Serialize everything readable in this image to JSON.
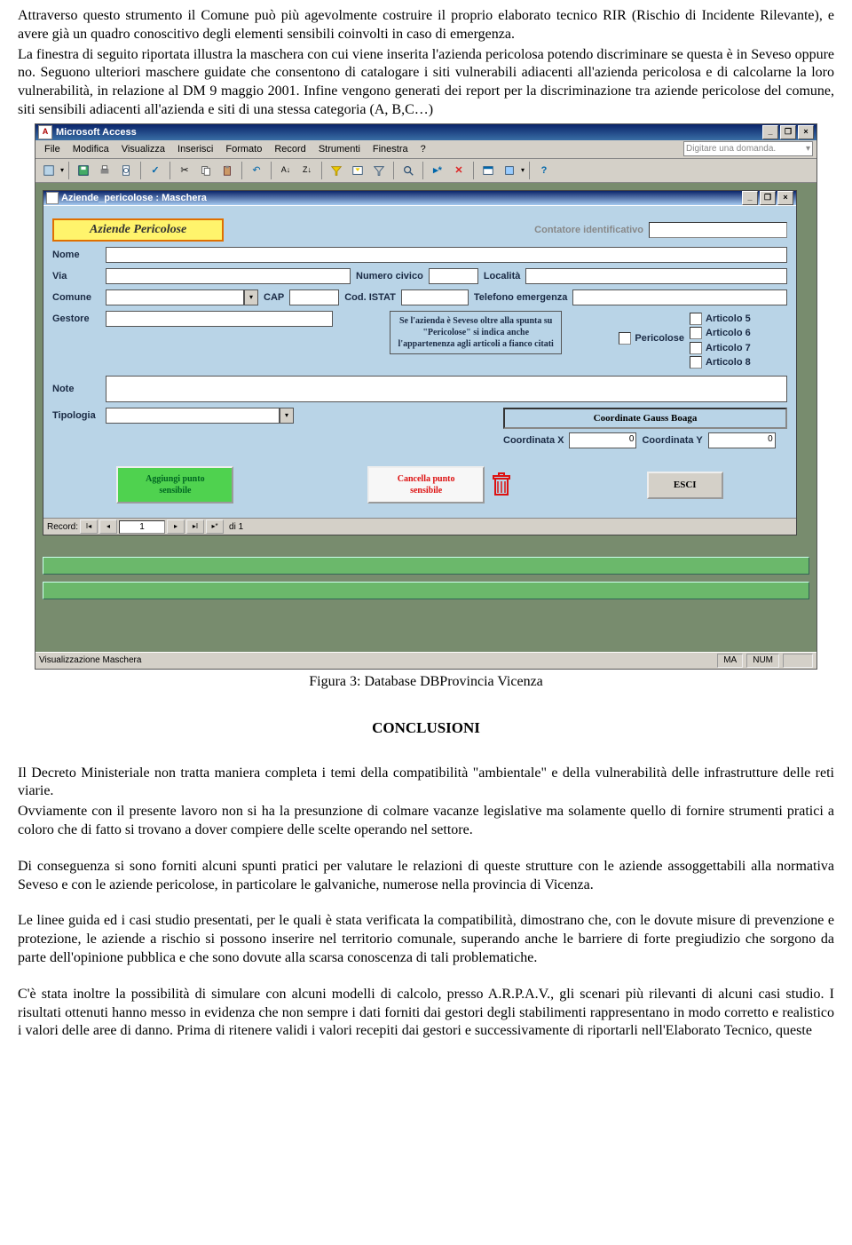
{
  "para1": "Attraverso questo strumento il Comune può più agevolmente costruire il proprio elaborato tecnico RIR (Rischio di Incidente Rilevante), e avere già un quadro conoscitivo degli elementi sensibili coinvolti in caso di emergenza.",
  "para2": "La finestra di seguito riportata illustra la maschera con cui viene inserita l'azienda pericolosa potendo discriminare se questa è in Seveso oppure no. Seguono ulteriori maschere guidate che consentono di catalogare i siti vulnerabili adiacenti all'azienda pericolosa e di calcolarne la loro vulnerabilità, in relazione al DM 9 maggio 2001. Infine vengono generati dei report  per la discriminazione tra aziende pericolose del comune, siti sensibili adiacenti all'azienda e siti di una stessa categoria (A, B,C…)",
  "caption": "Figura 3: Database DBProvincia Vicenza",
  "conclusion_heading": "CONCLUSIONI",
  "c1": "Il Decreto Ministeriale non tratta maniera completa i temi  della compatibilità \"ambientale\" e della vulnerabilità delle infrastrutture delle reti viarie.",
  "c2": "Ovviamente con il presente lavoro non si ha la presunzione di colmare vacanze legislative ma solamente quello di fornire strumenti pratici a coloro che di fatto si trovano a dover compiere delle scelte operando nel settore.",
  "c3": "Di conseguenza si sono forniti alcuni spunti pratici per valutare le relazioni di queste strutture con le aziende assoggettabili alla normativa Seveso e con le aziende pericolose, in particolare le  galvaniche, numerose nella provincia di Vicenza.",
  "c4": "Le linee guida ed i casi studio presentati, per le quali è stata verificata la compatibilità, dimostrano che, con le dovute misure di prevenzione e protezione, le aziende a rischio si possono inserire nel territorio comunale, superando anche le barriere di forte pregiudizio che sorgono da parte dell'opinione pubblica e che sono dovute alla scarsa conoscenza di tali problematiche.",
  "c5": "C'è stata inoltre la possibilità di simulare con alcuni modelli di calcolo, presso A.R.P.A.V., gli scenari più rilevanti di alcuni casi studio. I risultati ottenuti hanno messo in evidenza che non sempre i dati forniti dai gestori degli stabilimenti rappresentano in modo corretto e realistico i valori delle aree di danno. Prima di ritenere validi i valori recepiti dai gestori e successivamente di riportarli nell'Elaborato Tecnico, queste",
  "app": {
    "title": "Microsoft Access",
    "menus": [
      "File",
      "Modifica",
      "Visualizza",
      "Inserisci",
      "Formato",
      "Record",
      "Strumenti",
      "Finestra",
      "?"
    ],
    "askbox": "Digitare una domanda."
  },
  "formwin": {
    "title": "Aziende_pericolose : Maschera",
    "heading": "Aziende Pericolose",
    "contatore": "Contatore identificativo",
    "labels": {
      "nome": "Nome",
      "via": "Via",
      "numciv": "Numero civico",
      "localita": "Località",
      "comune": "Comune",
      "cap": "CAP",
      "istat": "Cod. ISTAT",
      "tel": "Telefono emergenza",
      "gestore": "Gestore",
      "note": "Note",
      "tipologia": "Tipologia",
      "coordx": "Coordinata X",
      "coordy": "Coordinata Y",
      "pericolose": "Pericolose"
    },
    "notebox": "Se l'azienda è Seveso oltre alla spunta su \"Pericolose\" si indica anche l'appartenenza agli articoli a fianco citati",
    "articoli": [
      "Articolo 5",
      "Articolo 6",
      "Articolo 7",
      "Articolo 8"
    ],
    "gauss": "Coordinate Gauss Boaga",
    "coordx_val": "0",
    "coordy_val": "0",
    "btn_add": "Aggiungi punto sensibile",
    "btn_del": "Cancella punto sensibile",
    "btn_exit": "ESCI",
    "record_label": "Record:",
    "record_pos": "1",
    "record_of": "di 1"
  },
  "status": {
    "left": "Visualizzazione Maschera",
    "ma": "MA",
    "num": "NUM"
  }
}
